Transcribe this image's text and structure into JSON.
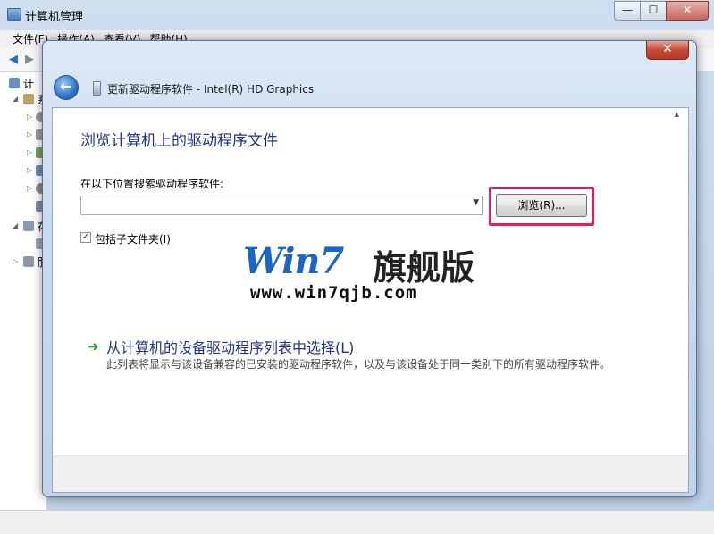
{
  "background_window": {
    "title": "计算机管理",
    "controls": {
      "minimize": "—",
      "maximize": "☐",
      "close": "✕"
    },
    "menu": [
      "文件(F)",
      "操作(A)",
      "查看(V)",
      "帮助(H)"
    ],
    "tree_items": [
      {
        "label": "计",
        "expanded": ""
      },
      {
        "label": "系",
        "expanded": "◢"
      },
      {
        "label": "",
        "expanded": "▷"
      },
      {
        "label": "",
        "expanded": "▷"
      },
      {
        "label": "",
        "expanded": "▷"
      },
      {
        "label": "",
        "expanded": "▷"
      },
      {
        "label": "",
        "expanded": "▷"
      },
      {
        "label": "",
        "expanded": ""
      },
      {
        "label": "存",
        "expanded": "◢"
      },
      {
        "label": "",
        "expanded": ""
      },
      {
        "label": "服",
        "expanded": "▷"
      }
    ]
  },
  "dialog": {
    "title": "更新驱动程序软件 - Intel(R) HD Graphics",
    "close_glyph": "✕",
    "back_glyph": "←",
    "heading": "浏览计算机上的驱动程序文件",
    "search_label": "在以下位置搜索驱动程序软件:",
    "path_value": "",
    "combo_arrow": "▼",
    "browse_button": "浏览(R)...",
    "include_subfolders": {
      "label": "包括子文件夹(I)",
      "checked": true,
      "check_glyph": "✓"
    },
    "option": {
      "arrow": "➜",
      "title": "从计算机的设备驱动程序列表中选择(L)",
      "description": "此列表将显示与该设备兼容的已安装的驱动程序软件，以及与该设备处于同一类别下的所有驱动程序软件。"
    },
    "highlight_color": "#d6245e"
  },
  "watermark": {
    "logo": "Win7",
    "logo_cn": "旗舰版",
    "url": "www.win7qjb.com"
  }
}
